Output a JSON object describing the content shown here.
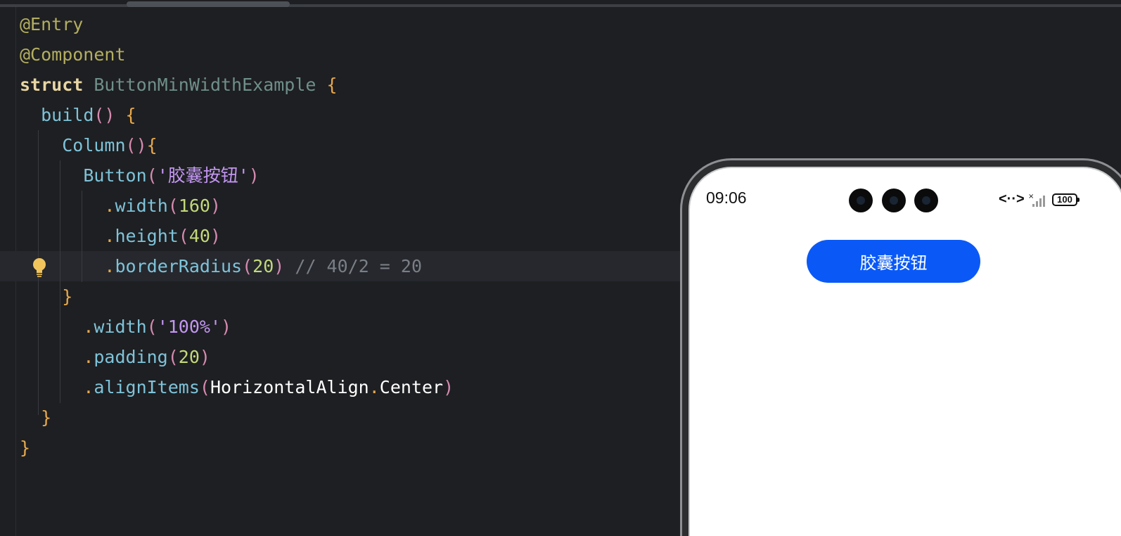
{
  "editor": {
    "lines": [
      {
        "tokens": [
          {
            "t": "@Entry",
            "c": "kw-annot"
          }
        ]
      },
      {
        "tokens": [
          {
            "t": "@Component",
            "c": "kw-annot"
          }
        ]
      },
      {
        "tokens": [
          {
            "t": "struct",
            "c": "kw"
          },
          {
            "t": " ",
            "c": "plain"
          },
          {
            "t": "ButtonMinWidthExample",
            "c": "cls"
          },
          {
            "t": " {",
            "c": "brace"
          }
        ]
      },
      {
        "tokens": [
          {
            "t": "  ",
            "c": "plain"
          },
          {
            "t": "build",
            "c": "fn"
          },
          {
            "t": "()",
            "c": "paren1"
          },
          {
            "t": " {",
            "c": "brace"
          }
        ]
      },
      {
        "tokens": [
          {
            "t": "    ",
            "c": "plain"
          },
          {
            "t": "Column",
            "c": "fn"
          },
          {
            "t": "()",
            "c": "paren1"
          },
          {
            "t": "{",
            "c": "brace"
          }
        ]
      },
      {
        "tokens": [
          {
            "t": "      ",
            "c": "plain"
          },
          {
            "t": "Button",
            "c": "fn"
          },
          {
            "t": "(",
            "c": "paren1"
          },
          {
            "t": "'胶囊按钮'",
            "c": "str"
          },
          {
            "t": ")",
            "c": "paren1"
          }
        ]
      },
      {
        "tokens": [
          {
            "t": "        ",
            "c": "plain"
          },
          {
            "t": ".",
            "c": "dot"
          },
          {
            "t": "width",
            "c": "fn"
          },
          {
            "t": "(",
            "c": "paren1"
          },
          {
            "t": "160",
            "c": "num"
          },
          {
            "t": ")",
            "c": "paren1"
          }
        ]
      },
      {
        "tokens": [
          {
            "t": "        ",
            "c": "plain"
          },
          {
            "t": ".",
            "c": "dot"
          },
          {
            "t": "height",
            "c": "fn"
          },
          {
            "t": "(",
            "c": "paren1"
          },
          {
            "t": "40",
            "c": "num"
          },
          {
            "t": ")",
            "c": "paren1"
          }
        ]
      },
      {
        "tokens": [
          {
            "t": "        ",
            "c": "plain"
          },
          {
            "t": ".",
            "c": "dot"
          },
          {
            "t": "borderRadius",
            "c": "fn"
          },
          {
            "t": "(",
            "c": "paren1"
          },
          {
            "t": "20",
            "c": "num"
          },
          {
            "t": ")",
            "c": "paren1"
          },
          {
            "t": " // 40/2 = 20",
            "c": "comment"
          }
        ],
        "current": true
      },
      {
        "tokens": [
          {
            "t": "    ",
            "c": "plain"
          },
          {
            "t": "}",
            "c": "brace"
          }
        ]
      },
      {
        "tokens": [
          {
            "t": "      ",
            "c": "plain"
          },
          {
            "t": ".",
            "c": "dot"
          },
          {
            "t": "width",
            "c": "fn"
          },
          {
            "t": "(",
            "c": "paren1"
          },
          {
            "t": "'100%'",
            "c": "str"
          },
          {
            "t": ")",
            "c": "paren1"
          }
        ]
      },
      {
        "tokens": [
          {
            "t": "      ",
            "c": "plain"
          },
          {
            "t": ".",
            "c": "dot"
          },
          {
            "t": "padding",
            "c": "fn"
          },
          {
            "t": "(",
            "c": "paren1"
          },
          {
            "t": "20",
            "c": "num"
          },
          {
            "t": ")",
            "c": "paren1"
          }
        ]
      },
      {
        "tokens": [
          {
            "t": "      ",
            "c": "plain"
          },
          {
            "t": ".",
            "c": "dot"
          },
          {
            "t": "alignItems",
            "c": "fn"
          },
          {
            "t": "(",
            "c": "paren1"
          },
          {
            "t": "HorizontalAlign",
            "c": "plain"
          },
          {
            "t": ".",
            "c": "dot"
          },
          {
            "t": "Center",
            "c": "plain"
          },
          {
            "t": ")",
            "c": "paren1"
          }
        ]
      },
      {
        "tokens": [
          {
            "t": "  ",
            "c": "plain"
          },
          {
            "t": "}",
            "c": "brace"
          }
        ]
      },
      {
        "tokens": [
          {
            "t": "}",
            "c": "brace"
          }
        ]
      }
    ]
  },
  "preview": {
    "time": "09:06",
    "network_glyph": "<··>",
    "signal_icon": "signal-bars-icon",
    "battery": "100",
    "button_label": "胶囊按钮",
    "button_color": "#0a59f7"
  }
}
